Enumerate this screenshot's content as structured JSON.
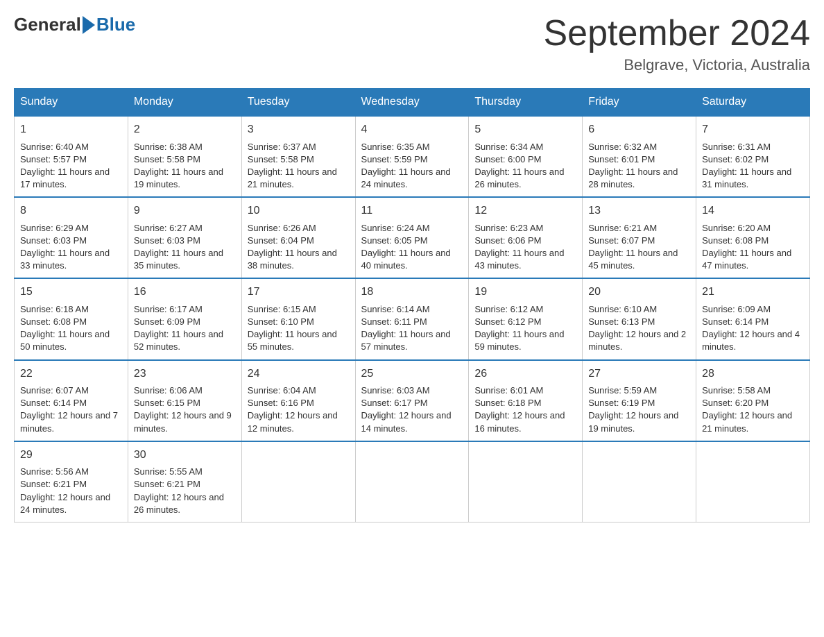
{
  "header": {
    "logo_general": "General",
    "logo_blue": "Blue",
    "month_title": "September 2024",
    "location": "Belgrave, Victoria, Australia"
  },
  "days_of_week": [
    "Sunday",
    "Monday",
    "Tuesday",
    "Wednesday",
    "Thursday",
    "Friday",
    "Saturday"
  ],
  "weeks": [
    [
      {
        "day": "1",
        "sunrise": "6:40 AM",
        "sunset": "5:57 PM",
        "daylight": "11 hours and 17 minutes."
      },
      {
        "day": "2",
        "sunrise": "6:38 AM",
        "sunset": "5:58 PM",
        "daylight": "11 hours and 19 minutes."
      },
      {
        "day": "3",
        "sunrise": "6:37 AM",
        "sunset": "5:58 PM",
        "daylight": "11 hours and 21 minutes."
      },
      {
        "day": "4",
        "sunrise": "6:35 AM",
        "sunset": "5:59 PM",
        "daylight": "11 hours and 24 minutes."
      },
      {
        "day": "5",
        "sunrise": "6:34 AM",
        "sunset": "6:00 PM",
        "daylight": "11 hours and 26 minutes."
      },
      {
        "day": "6",
        "sunrise": "6:32 AM",
        "sunset": "6:01 PM",
        "daylight": "11 hours and 28 minutes."
      },
      {
        "day": "7",
        "sunrise": "6:31 AM",
        "sunset": "6:02 PM",
        "daylight": "11 hours and 31 minutes."
      }
    ],
    [
      {
        "day": "8",
        "sunrise": "6:29 AM",
        "sunset": "6:03 PM",
        "daylight": "11 hours and 33 minutes."
      },
      {
        "day": "9",
        "sunrise": "6:27 AM",
        "sunset": "6:03 PM",
        "daylight": "11 hours and 35 minutes."
      },
      {
        "day": "10",
        "sunrise": "6:26 AM",
        "sunset": "6:04 PM",
        "daylight": "11 hours and 38 minutes."
      },
      {
        "day": "11",
        "sunrise": "6:24 AM",
        "sunset": "6:05 PM",
        "daylight": "11 hours and 40 minutes."
      },
      {
        "day": "12",
        "sunrise": "6:23 AM",
        "sunset": "6:06 PM",
        "daylight": "11 hours and 43 minutes."
      },
      {
        "day": "13",
        "sunrise": "6:21 AM",
        "sunset": "6:07 PM",
        "daylight": "11 hours and 45 minutes."
      },
      {
        "day": "14",
        "sunrise": "6:20 AM",
        "sunset": "6:08 PM",
        "daylight": "11 hours and 47 minutes."
      }
    ],
    [
      {
        "day": "15",
        "sunrise": "6:18 AM",
        "sunset": "6:08 PM",
        "daylight": "11 hours and 50 minutes."
      },
      {
        "day": "16",
        "sunrise": "6:17 AM",
        "sunset": "6:09 PM",
        "daylight": "11 hours and 52 minutes."
      },
      {
        "day": "17",
        "sunrise": "6:15 AM",
        "sunset": "6:10 PM",
        "daylight": "11 hours and 55 minutes."
      },
      {
        "day": "18",
        "sunrise": "6:14 AM",
        "sunset": "6:11 PM",
        "daylight": "11 hours and 57 minutes."
      },
      {
        "day": "19",
        "sunrise": "6:12 AM",
        "sunset": "6:12 PM",
        "daylight": "11 hours and 59 minutes."
      },
      {
        "day": "20",
        "sunrise": "6:10 AM",
        "sunset": "6:13 PM",
        "daylight": "12 hours and 2 minutes."
      },
      {
        "day": "21",
        "sunrise": "6:09 AM",
        "sunset": "6:14 PM",
        "daylight": "12 hours and 4 minutes."
      }
    ],
    [
      {
        "day": "22",
        "sunrise": "6:07 AM",
        "sunset": "6:14 PM",
        "daylight": "12 hours and 7 minutes."
      },
      {
        "day": "23",
        "sunrise": "6:06 AM",
        "sunset": "6:15 PM",
        "daylight": "12 hours and 9 minutes."
      },
      {
        "day": "24",
        "sunrise": "6:04 AM",
        "sunset": "6:16 PM",
        "daylight": "12 hours and 12 minutes."
      },
      {
        "day": "25",
        "sunrise": "6:03 AM",
        "sunset": "6:17 PM",
        "daylight": "12 hours and 14 minutes."
      },
      {
        "day": "26",
        "sunrise": "6:01 AM",
        "sunset": "6:18 PM",
        "daylight": "12 hours and 16 minutes."
      },
      {
        "day": "27",
        "sunrise": "5:59 AM",
        "sunset": "6:19 PM",
        "daylight": "12 hours and 19 minutes."
      },
      {
        "day": "28",
        "sunrise": "5:58 AM",
        "sunset": "6:20 PM",
        "daylight": "12 hours and 21 minutes."
      }
    ],
    [
      {
        "day": "29",
        "sunrise": "5:56 AM",
        "sunset": "6:21 PM",
        "daylight": "12 hours and 24 minutes."
      },
      {
        "day": "30",
        "sunrise": "5:55 AM",
        "sunset": "6:21 PM",
        "daylight": "12 hours and 26 minutes."
      },
      null,
      null,
      null,
      null,
      null
    ]
  ]
}
